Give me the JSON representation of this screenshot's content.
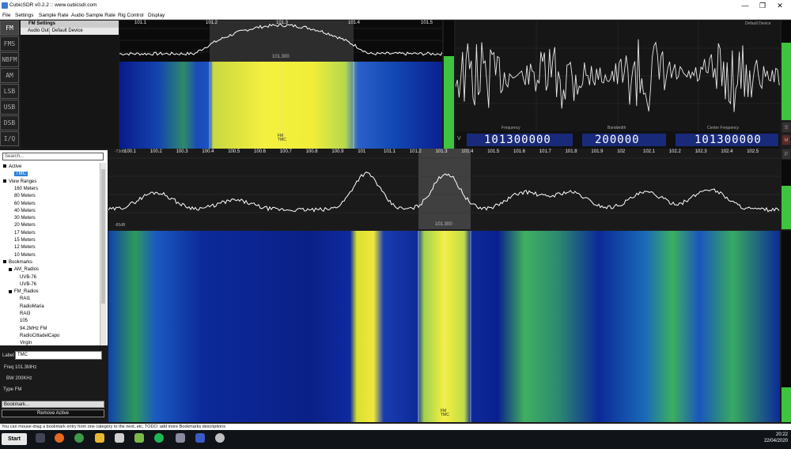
{
  "window": {
    "title": "CubicSDR v0.2.2 :: www.cubicsdr.com",
    "minimize": "—",
    "maximize": "❐",
    "close": "✕"
  },
  "menu": [
    "File",
    "Settings",
    "Sample Rate",
    "Audio Sample Rate",
    "Rig Control",
    "Display"
  ],
  "modes": [
    "FM",
    "FMS",
    "NBFM",
    "AM",
    "LSB",
    "USB",
    "DSB",
    "I/Q"
  ],
  "active_mode": "FM",
  "fm_settings": {
    "header": "FM Settings",
    "key": "Audio Out",
    "value": "Default Device"
  },
  "top_spectrum": {
    "ticks": [
      "101.1",
      "101.2",
      "101.3",
      "101.4",
      "101.5"
    ],
    "center_label": "101.300",
    "waterfall_tag": "FM\nTMC"
  },
  "scope": {
    "mode_label": "Default  Device"
  },
  "freq_display": {
    "freq_label": "Frequency",
    "freq_value": "101300000",
    "vmark": "V",
    "bw_label": "Bandwidth",
    "bw_value": "200000",
    "center_label": "Center Frequency",
    "center_value": "101300000",
    "side_buttons": [
      "S",
      "M",
      "P"
    ]
  },
  "main_spectrum": {
    "db_top": "-73dB",
    "db_bottom": "-85dB",
    "ticks": [
      "100.1",
      "100.2",
      "100.3",
      "100.4",
      "100.5",
      "100.6",
      "100.7",
      "100.8",
      "100.9",
      "101",
      "101.1",
      "101.2",
      "101.3",
      "101.4",
      "101.5",
      "101.6",
      "101.7",
      "101.8",
      "101.9",
      "102",
      "102.1",
      "102.2",
      "102.3",
      "102.4",
      "102.5"
    ],
    "center_label": "101.300",
    "waterfall_tag": "FM\nTMC"
  },
  "search": {
    "placeholder": "Search..."
  },
  "tree": [
    {
      "label": "Active",
      "level": 0,
      "box": true
    },
    {
      "label": "TMC",
      "level": 2,
      "selected": true
    },
    {
      "label": "View Ranges",
      "level": 0,
      "box": true
    },
    {
      "label": "160 Meters",
      "level": 2
    },
    {
      "label": "80 Meters",
      "level": 2
    },
    {
      "label": "60 Meters",
      "level": 2
    },
    {
      "label": "40 Meters",
      "level": 2
    },
    {
      "label": "30 Meters",
      "level": 2
    },
    {
      "label": "20 Meters",
      "level": 2
    },
    {
      "label": "17 Meters",
      "level": 2
    },
    {
      "label": "15 Meters",
      "level": 2
    },
    {
      "label": "12 Meters",
      "level": 2
    },
    {
      "label": "10 Meters",
      "level": 2
    },
    {
      "label": "Bookmarks",
      "level": 0,
      "box": true
    },
    {
      "label": "AM_Radios",
      "level": 1,
      "box": true
    },
    {
      "label": "UVB-76",
      "level": 3
    },
    {
      "label": "UVB-76",
      "level": 3
    },
    {
      "label": "FM_Radios",
      "level": 1,
      "box": true
    },
    {
      "label": "RAI1",
      "level": 3
    },
    {
      "label": "RadioMaria",
      "level": 3
    },
    {
      "label": "RAI3",
      "level": 3
    },
    {
      "label": "105",
      "level": 3
    },
    {
      "label": "94.2MHz FM",
      "level": 3
    },
    {
      "label": "RadioCittadelCapo",
      "level": 3
    },
    {
      "label": "Virgin",
      "level": 3
    }
  ],
  "details": {
    "label_caption": "Label",
    "label_value": "TMC",
    "freq_line": "Freq 101.3MHz",
    "bw_line": "BW 200KHz",
    "type_line": "Type FM",
    "bookmark_select": "Bookmark...",
    "remove_button": "Remove Active"
  },
  "status": "You can mouse-drag a bookmark entry from one category to the next..etc. TODO: add more Bookmarks descriptions",
  "taskbar": {
    "start": "Start",
    "time": "20:22",
    "date": "22/04/2020"
  },
  "colors": {
    "accent": "#2a7fd4",
    "meter": "#3ec43e",
    "digit_box": "#1a2a7a"
  }
}
